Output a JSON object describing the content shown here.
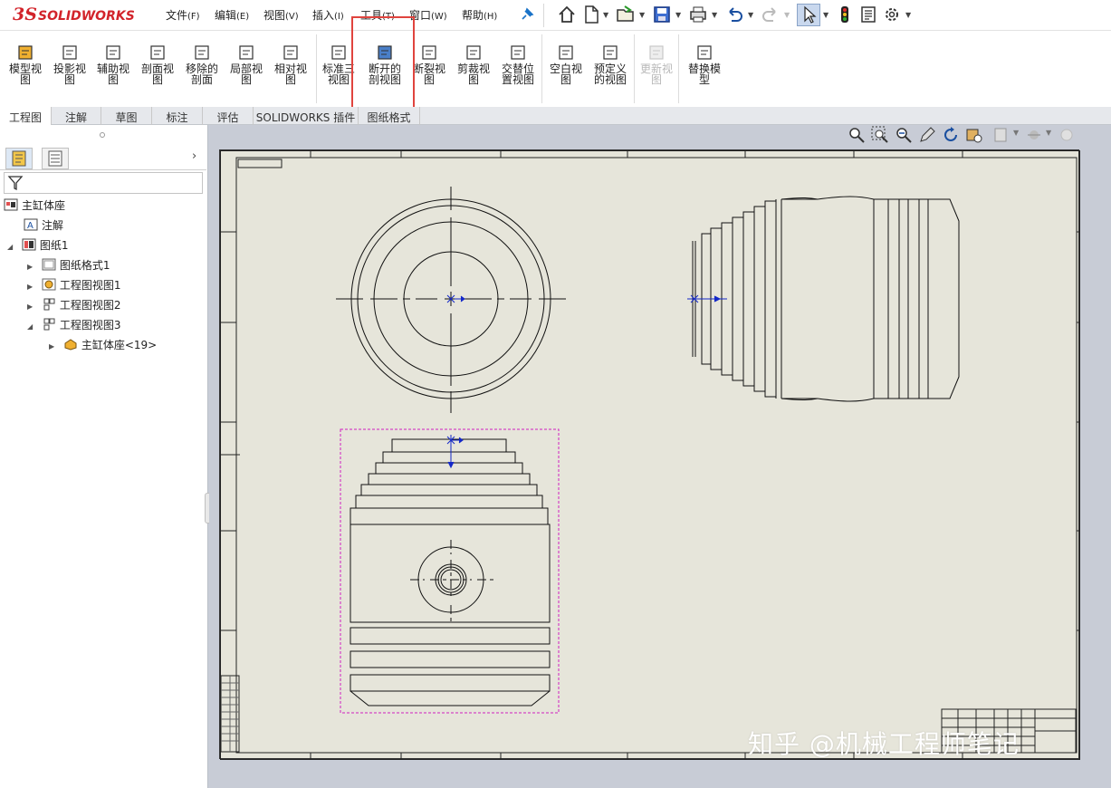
{
  "app": {
    "logo_ds": "3S",
    "logo_name": "SOLIDWORKS"
  },
  "menu": [
    {
      "label": "文件",
      "key": "(F)"
    },
    {
      "label": "编辑",
      "key": "(E)"
    },
    {
      "label": "视图",
      "key": "(V)"
    },
    {
      "label": "插入",
      "key": "(I)"
    },
    {
      "label": "工具",
      "key": "(T)"
    },
    {
      "label": "窗口",
      "key": "(W)"
    },
    {
      "label": "帮助",
      "key": "(H)"
    }
  ],
  "commands": [
    {
      "l1": "模型视",
      "l2": "图"
    },
    {
      "l1": "投影视",
      "l2": "图"
    },
    {
      "l1": "辅助视",
      "l2": "图"
    },
    {
      "l1": "剖面视",
      "l2": "图"
    },
    {
      "l1": "移除的",
      "l2": "剖面"
    },
    {
      "l1": "局部视",
      "l2": "图"
    },
    {
      "l1": "相对视",
      "l2": "图"
    },
    {
      "l1": "标准三",
      "l2": "视图"
    },
    {
      "l1": "断开的",
      "l2": "剖视图"
    },
    {
      "l1": "断裂视",
      "l2": "图"
    },
    {
      "l1": "剪裁视",
      "l2": "图"
    },
    {
      "l1": "交替位",
      "l2": "置视图"
    },
    {
      "l1": "空白视",
      "l2": "图"
    },
    {
      "l1": "预定义",
      "l2": "的视图"
    },
    {
      "l1": "更新视",
      "l2": "图"
    },
    {
      "l1": "替换模",
      "l2": "型"
    }
  ],
  "tabs": [
    "工程图",
    "注解",
    "草图",
    "标注",
    "评估",
    "SOLIDWORKS 插件",
    "图纸格式"
  ],
  "tree": {
    "root": "主缸体座",
    "annotations": "注解",
    "sheet": "图纸1",
    "sheet_format": "图纸格式1",
    "view1": "工程图视图1",
    "view2": "工程图视图2",
    "view3": "工程图视图3",
    "part": "主缸体座<19>"
  },
  "watermark": "知乎 @机械工程师笔记",
  "colors": {
    "accent": "#d2232a",
    "highlight": "#e0443e",
    "sheet": "#e6e5da",
    "selection": "#d020c0"
  }
}
